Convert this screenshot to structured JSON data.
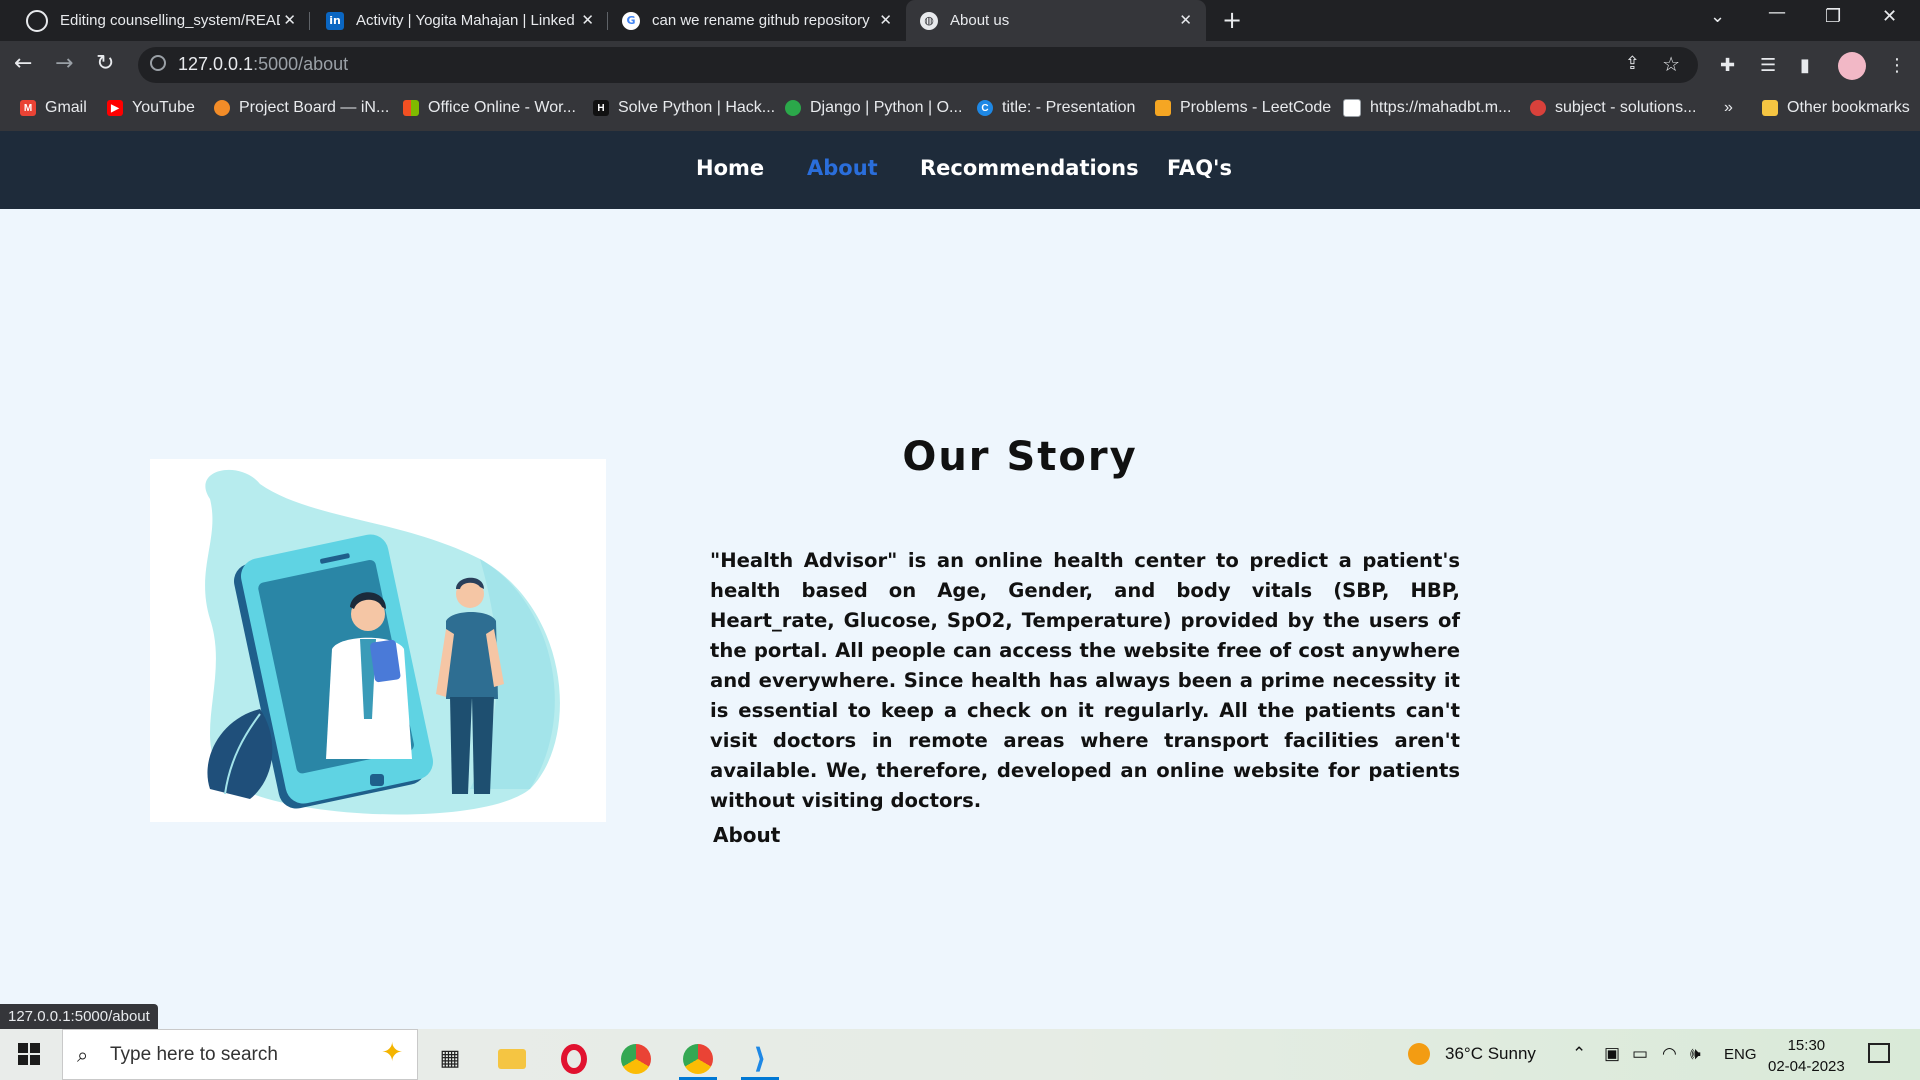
{
  "browser": {
    "tabs": [
      {
        "title": "Editing counselling_system/READ",
        "icon": "github-icon",
        "active": false
      },
      {
        "title": "Activity | Yogita Mahajan | Linked",
        "icon": "linkedin-icon",
        "active": false
      },
      {
        "title": "can we rename github repository",
        "icon": "google-icon",
        "active": false
      },
      {
        "title": "About us",
        "icon": "globe-icon",
        "active": true
      }
    ],
    "address": {
      "host": "127.0.0.1",
      "path": ":5000/about"
    },
    "bookmarks": [
      {
        "label": "Gmail",
        "icon": "gmail-icon",
        "color": "#ea4335"
      },
      {
        "label": "YouTube",
        "icon": "youtube-icon",
        "color": "#ff0000"
      },
      {
        "label": "Project Board — iN...",
        "icon": "project-board-icon",
        "color": "#f28c28"
      },
      {
        "label": "Office Online - Wor...",
        "icon": "office-icon",
        "color": "#f25022"
      },
      {
        "label": "Solve Python | Hack...",
        "icon": "hackerrank-icon",
        "color": "#111111"
      },
      {
        "label": "Django | Python | O...",
        "icon": "django-icon",
        "color": "#2ba84a"
      },
      {
        "label": "title: - Presentation",
        "icon": "canva-icon",
        "color": "#1e88e5"
      },
      {
        "label": "Problems - LeetCode",
        "icon": "leetcode-icon",
        "color": "#f5a623"
      },
      {
        "label": "https://mahadbt.m...",
        "icon": "page-icon",
        "color": "#ffffff"
      },
      {
        "label": "subject - solutions...",
        "icon": "apple-icon",
        "color": "#d9413b"
      }
    ],
    "more_bookmarks": "»",
    "other_bookmarks": "Other bookmarks",
    "status_url": "127.0.0.1:5000/about"
  },
  "site": {
    "nav": [
      {
        "label": "Home",
        "active": false
      },
      {
        "label": "About",
        "active": true
      },
      {
        "label": "Recommendations",
        "active": false
      },
      {
        "label": "FAQ's",
        "active": false
      }
    ],
    "heading": "Our Story",
    "paragraph": "\"Health Advisor\" is an online health center to predict a patient's health based on Age, Gender, and body vitals (SBP, HBP, Heart_rate, Glucose, SpO2, Temperature) provided by the users of the portal. All people can access the website free of cost anywhere and everywhere. Since health has always been a prime necessity it is essential to keep a check on it regularly. All the patients can't visit doctors in remote areas where transport facilities aren't available. We, therefore, developed an online website for patients without visiting doctors.",
    "sub_heading": "About"
  },
  "taskbar": {
    "search_placeholder": "Type here to search",
    "apps": [
      "task-view-icon",
      "file-explorer-icon",
      "opera-icon",
      "chrome-icon",
      "chrome-icon",
      "vscode-icon"
    ],
    "weather": "36°C  Sunny",
    "language": "ENG",
    "time": "15:30",
    "date": "02-04-2023"
  },
  "colors": {
    "site_nav_bg": "#1e2b3a",
    "site_active_link": "#2a6edb",
    "page_bg": "#eef6fd",
    "illustration_teal": "#5fd3e3"
  }
}
